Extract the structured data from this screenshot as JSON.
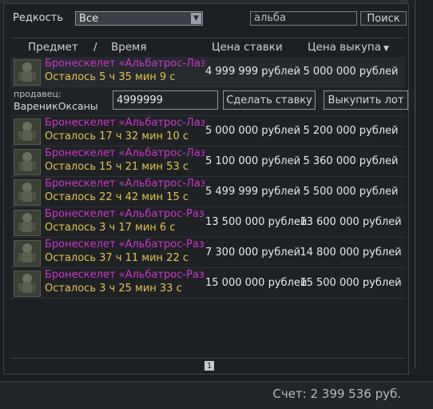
{
  "filter": {
    "rarity_label": "Редкость",
    "rarity_value": "Все",
    "search_value": "альба",
    "search_button": "Поиск"
  },
  "columns": {
    "item": "Предмет",
    "separator": "/",
    "time": "Время",
    "bid_price": "Цена ставки",
    "buyout_price": "Цена выкупа"
  },
  "lots": [
    {
      "name": "Бронескелет «Альбатрос-Лазут...",
      "time_left": "Осталось 5 ч 35 мин 9 с",
      "bid": "4 999 999 рублей",
      "buyout": "5 000 000 рублей"
    },
    {
      "name": "Бронескелет «Альбатрос-Лазут...",
      "time_left": "Осталось 17 ч 32 мин 10 с",
      "bid": "5 000 000 рублей",
      "buyout": "5 200 000 рублей"
    },
    {
      "name": "Бронескелет «Альбатрос-Лазут...",
      "time_left": "Осталось 15 ч 21 мин 53 с",
      "bid": "5 100 000 рублей",
      "buyout": "5 360 000 рублей"
    },
    {
      "name": "Бронескелет «Альбатрос-Лазут...",
      "time_left": "Осталось 22 ч 42 мин 15 с",
      "bid": "5 499 999 рублей",
      "buyout": "5 500 000 рублей"
    },
    {
      "name": "Бронескелет «Альбатрос-Разве...",
      "time_left": "Осталось 3 ч 17 мин 6 с",
      "bid": "13 500 000 рублей",
      "buyout": "13 600 000 рублей"
    },
    {
      "name": "Бронескелет «Альбатрос-Разве...",
      "time_left": "Осталось 37 ч 11 мин 22 с",
      "bid": "7 300 000 рублей",
      "buyout": "14 800 000 рублей"
    },
    {
      "name": "Бронескелет «Альбатрос-Разве...",
      "time_left": "Осталось 3 ч 25 мин 33 с",
      "bid": "15 000 000 рублей",
      "buyout": "15 500 000 рублей"
    }
  ],
  "detail": {
    "seller_label": "продавец:",
    "seller_name": "ВареникОксаны",
    "bid_input_value": "4999999",
    "make_bid_button": "Сделать ставку",
    "buyout_button": "Выкупить лот"
  },
  "pagination": {
    "current_page": "1"
  },
  "footer": {
    "account": "Счет: 2 399 536 руб."
  },
  "colors": {
    "item_name": "#cc35c8",
    "time_left": "#e3c24a"
  }
}
